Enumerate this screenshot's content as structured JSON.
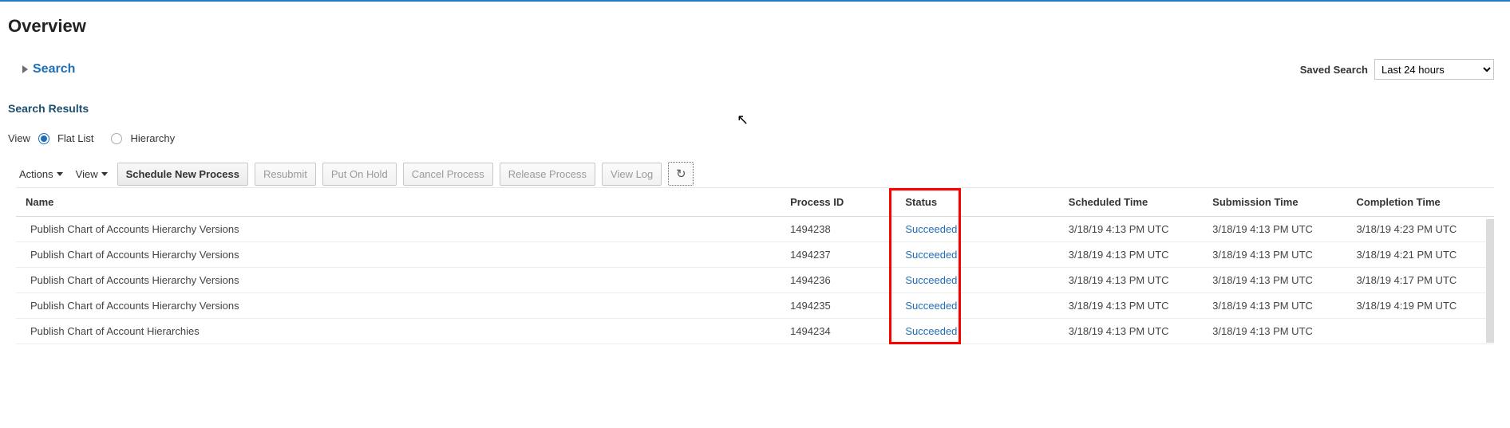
{
  "page_title": "Overview",
  "search": {
    "toggle_label": "Search"
  },
  "saved_search": {
    "label": "Saved Search",
    "selected": "Last 24 hours"
  },
  "section_title": "Search Results",
  "view": {
    "label": "View",
    "options": {
      "flat": "Flat List",
      "hierarchy": "Hierarchy"
    }
  },
  "toolbar": {
    "actions": "Actions",
    "view": "View",
    "schedule": "Schedule New Process",
    "resubmit": "Resubmit",
    "hold": "Put On Hold",
    "cancel": "Cancel Process",
    "release": "Release Process",
    "viewlog": "View Log"
  },
  "columns": {
    "name": "Name",
    "pid": "Process ID",
    "status": "Status",
    "sched": "Scheduled Time",
    "sub": "Submission Time",
    "comp": "Completion Time"
  },
  "rows": [
    {
      "name": "Publish Chart of Accounts Hierarchy Versions",
      "pid": "1494238",
      "status": "Succeeded",
      "sched": "3/18/19 4:13 PM UTC",
      "sub": "3/18/19 4:13 PM UTC",
      "comp": "3/18/19 4:23 PM UTC"
    },
    {
      "name": "Publish Chart of Accounts Hierarchy Versions",
      "pid": "1494237",
      "status": "Succeeded",
      "sched": "3/18/19 4:13 PM UTC",
      "sub": "3/18/19 4:13 PM UTC",
      "comp": "3/18/19 4:21 PM UTC"
    },
    {
      "name": "Publish Chart of Accounts Hierarchy Versions",
      "pid": "1494236",
      "status": "Succeeded",
      "sched": "3/18/19 4:13 PM UTC",
      "sub": "3/18/19 4:13 PM UTC",
      "comp": "3/18/19 4:17 PM UTC"
    },
    {
      "name": "Publish Chart of Accounts Hierarchy Versions",
      "pid": "1494235",
      "status": "Succeeded",
      "sched": "3/18/19 4:13 PM UTC",
      "sub": "3/18/19 4:13 PM UTC",
      "comp": "3/18/19 4:19 PM UTC"
    },
    {
      "name": "Publish Chart of Account Hierarchies",
      "pid": "1494234",
      "status": "Succeeded",
      "sched": "3/18/19 4:13 PM UTC",
      "sub": "3/18/19 4:13 PM UTC",
      "comp": ""
    }
  ]
}
